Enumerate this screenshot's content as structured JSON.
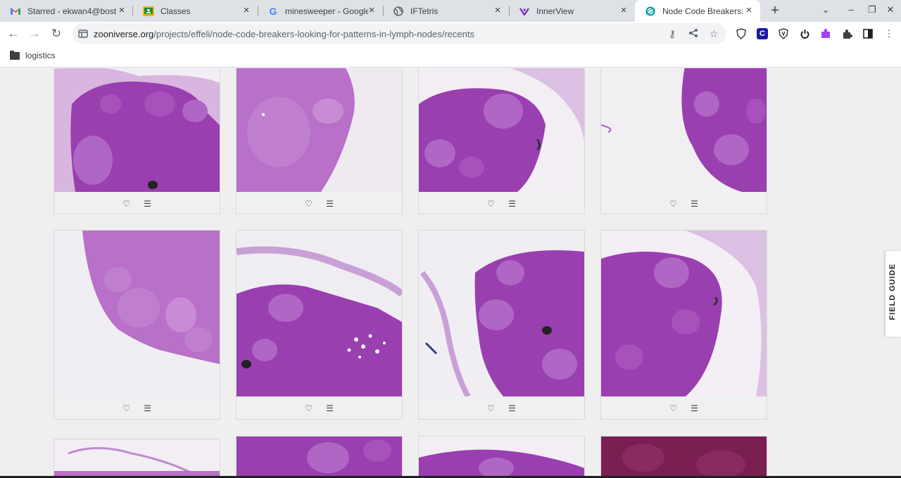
{
  "tabs": [
    {
      "title": "Starred - ekwan4@bost",
      "icon": "gmail-icon",
      "active": false
    },
    {
      "title": "Classes",
      "icon": "classroom-icon",
      "active": false
    },
    {
      "title": "minesweeper - Google S",
      "icon": "google-icon",
      "active": false
    },
    {
      "title": "IFTetris",
      "icon": "globe-icon",
      "active": false
    },
    {
      "title": "InnerView",
      "icon": "innerview-icon",
      "active": false
    },
    {
      "title": "Node Code Breakers: lo",
      "icon": "zooniverse-icon",
      "active": true
    }
  ],
  "address_bar": {
    "host": "zooniverse.org",
    "path": "/projects/effeli/node-code-breakers-looking-for-patterns-in-lymph-nodes/recents"
  },
  "bookmarks": [
    {
      "label": "logistics",
      "icon": "folder-icon"
    }
  ],
  "field_guide": {
    "label": "FIELD GUIDE"
  },
  "colors": {
    "tissue_purple": "#9a3fb0",
    "tissue_light": "#b870c8",
    "slide_bg": "#f4f1f5",
    "dark_stain": "#7a1f52"
  },
  "subjects_rows": [
    {
      "row": 1,
      "count": 4
    },
    {
      "row": 2,
      "count": 4
    },
    {
      "row": 3,
      "count": 4
    }
  ]
}
